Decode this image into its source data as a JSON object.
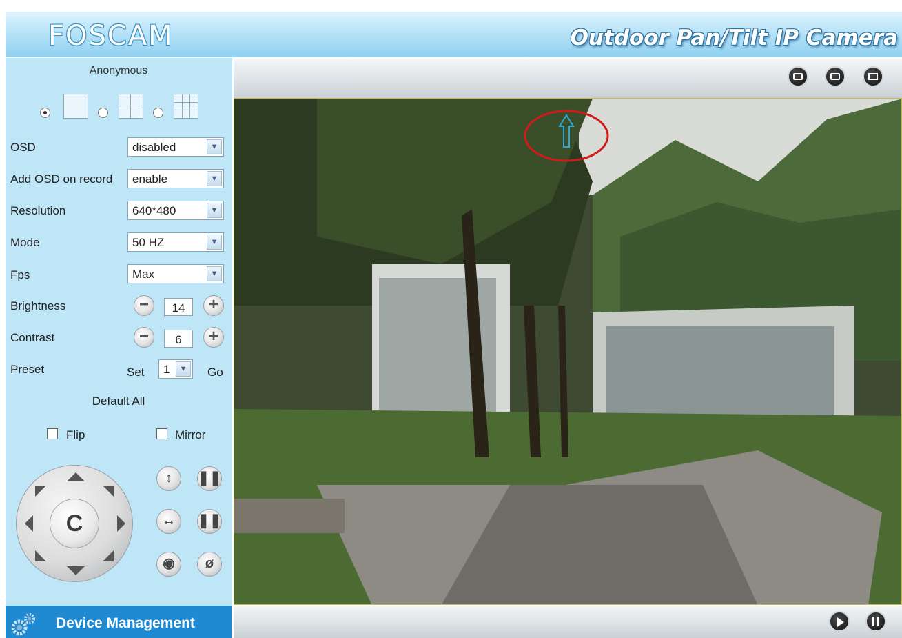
{
  "header": {
    "logo": "FOSCAM",
    "product": "Outdoor Pan/Tilt IP Camera"
  },
  "sidebar": {
    "user": "Anonymous",
    "layouts": [
      "1-view",
      "4-view",
      "9-view"
    ],
    "osd": {
      "label": "OSD",
      "value": "disabled"
    },
    "osd_record": {
      "label": "Add OSD on record",
      "value": "enable"
    },
    "resolution": {
      "label": "Resolution",
      "value": "640*480"
    },
    "mode": {
      "label": "Mode",
      "value": "50 HZ"
    },
    "fps": {
      "label": "Fps",
      "value": "Max"
    },
    "brightness": {
      "label": "Brightness",
      "value": "14"
    },
    "contrast": {
      "label": "Contrast",
      "value": "6"
    },
    "preset": {
      "label": "Preset",
      "set": "Set",
      "value": "1",
      "go": "Go"
    },
    "default_all": "Default All",
    "flip": "Flip",
    "mirror": "Mirror",
    "center_label": "C"
  },
  "device_management": "Device Management",
  "colors": {
    "sidebar_bg": "#bfe6f7",
    "accent": "#1f8ad1",
    "highlight_circle": "#d11a1a",
    "arrow": "#2fa8d8"
  }
}
